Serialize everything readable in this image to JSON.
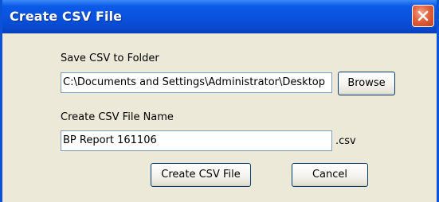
{
  "window": {
    "title": "Create CSV File"
  },
  "folder": {
    "label": "Save CSV to Folder",
    "value": "C:\\Documents and Settings\\Administrator\\Desktop",
    "browse_label": "Browse"
  },
  "file": {
    "label": "Create CSV File Name",
    "value": "BP Report 161106",
    "extension": ".csv"
  },
  "actions": {
    "create_label": "Create CSV File",
    "cancel_label": "Cancel"
  },
  "colors": {
    "titlebar": "#0a53de",
    "dialog_bg": "#ece9d8",
    "close_button": "#e2613c",
    "input_border": "#7f9db9"
  },
  "icons": {
    "close": "close-icon"
  }
}
